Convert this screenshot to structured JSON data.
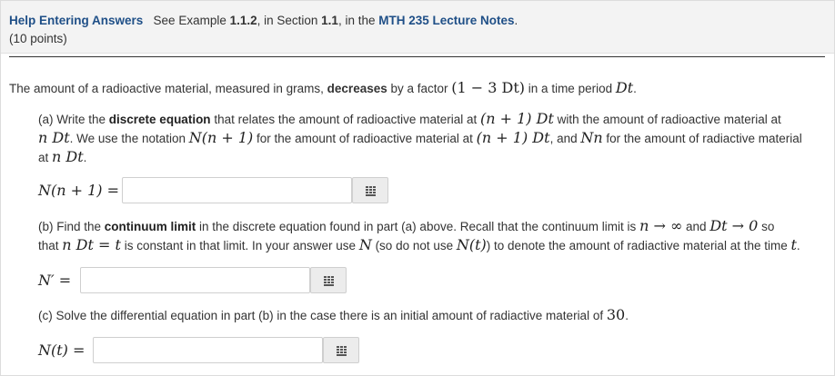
{
  "header": {
    "title": "Help Entering Answers",
    "see_prefix": "See Example ",
    "example_num": "1.1.2",
    "in_section": ", in Section ",
    "section_num": "1.1",
    "in_the": ", in the ",
    "notes_link": "MTH 235 Lecture Notes",
    "period": ".",
    "points": "(10 points)"
  },
  "intro": {
    "t1": "The amount of a radioactive material, measured in grams, ",
    "bold": "decreases",
    "t2": " by a factor ",
    "factor": "(1 − 3 Dt)",
    "t3": " in a time period ",
    "dt": "Dt",
    "end": "."
  },
  "part_a": {
    "t1": "(a) Write the ",
    "bold": "discrete equation",
    "t2": " that relates the amount of radioactive material at ",
    "m1": "(n + 1) Dt",
    "t3": " with the amount of radioactive material at",
    "m2": "n Dt",
    "t4": ". We use the notation ",
    "m3": "N(n + 1)",
    "t5": " for the amount of radioactive material at ",
    "m4": "(n + 1) Dt",
    "t6": ", and ",
    "m5": "Nn",
    "t7": " for the amount of radiactive material",
    "t8": "at ",
    "m6": "n Dt",
    "end": ".",
    "answer_label": "N(n + 1) =",
    "answer_value": ""
  },
  "part_b": {
    "t1": "(b) Find the ",
    "bold": "continuum limit",
    "t2": " in the discrete equation found in part (a) above. Recall that the continuum limit is ",
    "m1": "n → ∞",
    "t3": " and ",
    "m2": "Dt → 0",
    "t4": " so",
    "t5": "that ",
    "m3": "n Dt = t",
    "t6": " is constant in that limit. In your answer use ",
    "m4": "N",
    "t7": " (so do not use ",
    "m5": "N(t)",
    "t8": ") to denote the amount of radiactive material at the time ",
    "m6": "t",
    "end": ".",
    "answer_label": "N′ =",
    "answer_value": ""
  },
  "part_c": {
    "t1": "(c) Solve the differential equation in part (b) in the case there is an initial amount of radiactive material of ",
    "m1": "30",
    "end": ".",
    "answer_label": "N(t) =",
    "answer_value": ""
  },
  "icons": {
    "keyboard": "keyboard-icon"
  }
}
